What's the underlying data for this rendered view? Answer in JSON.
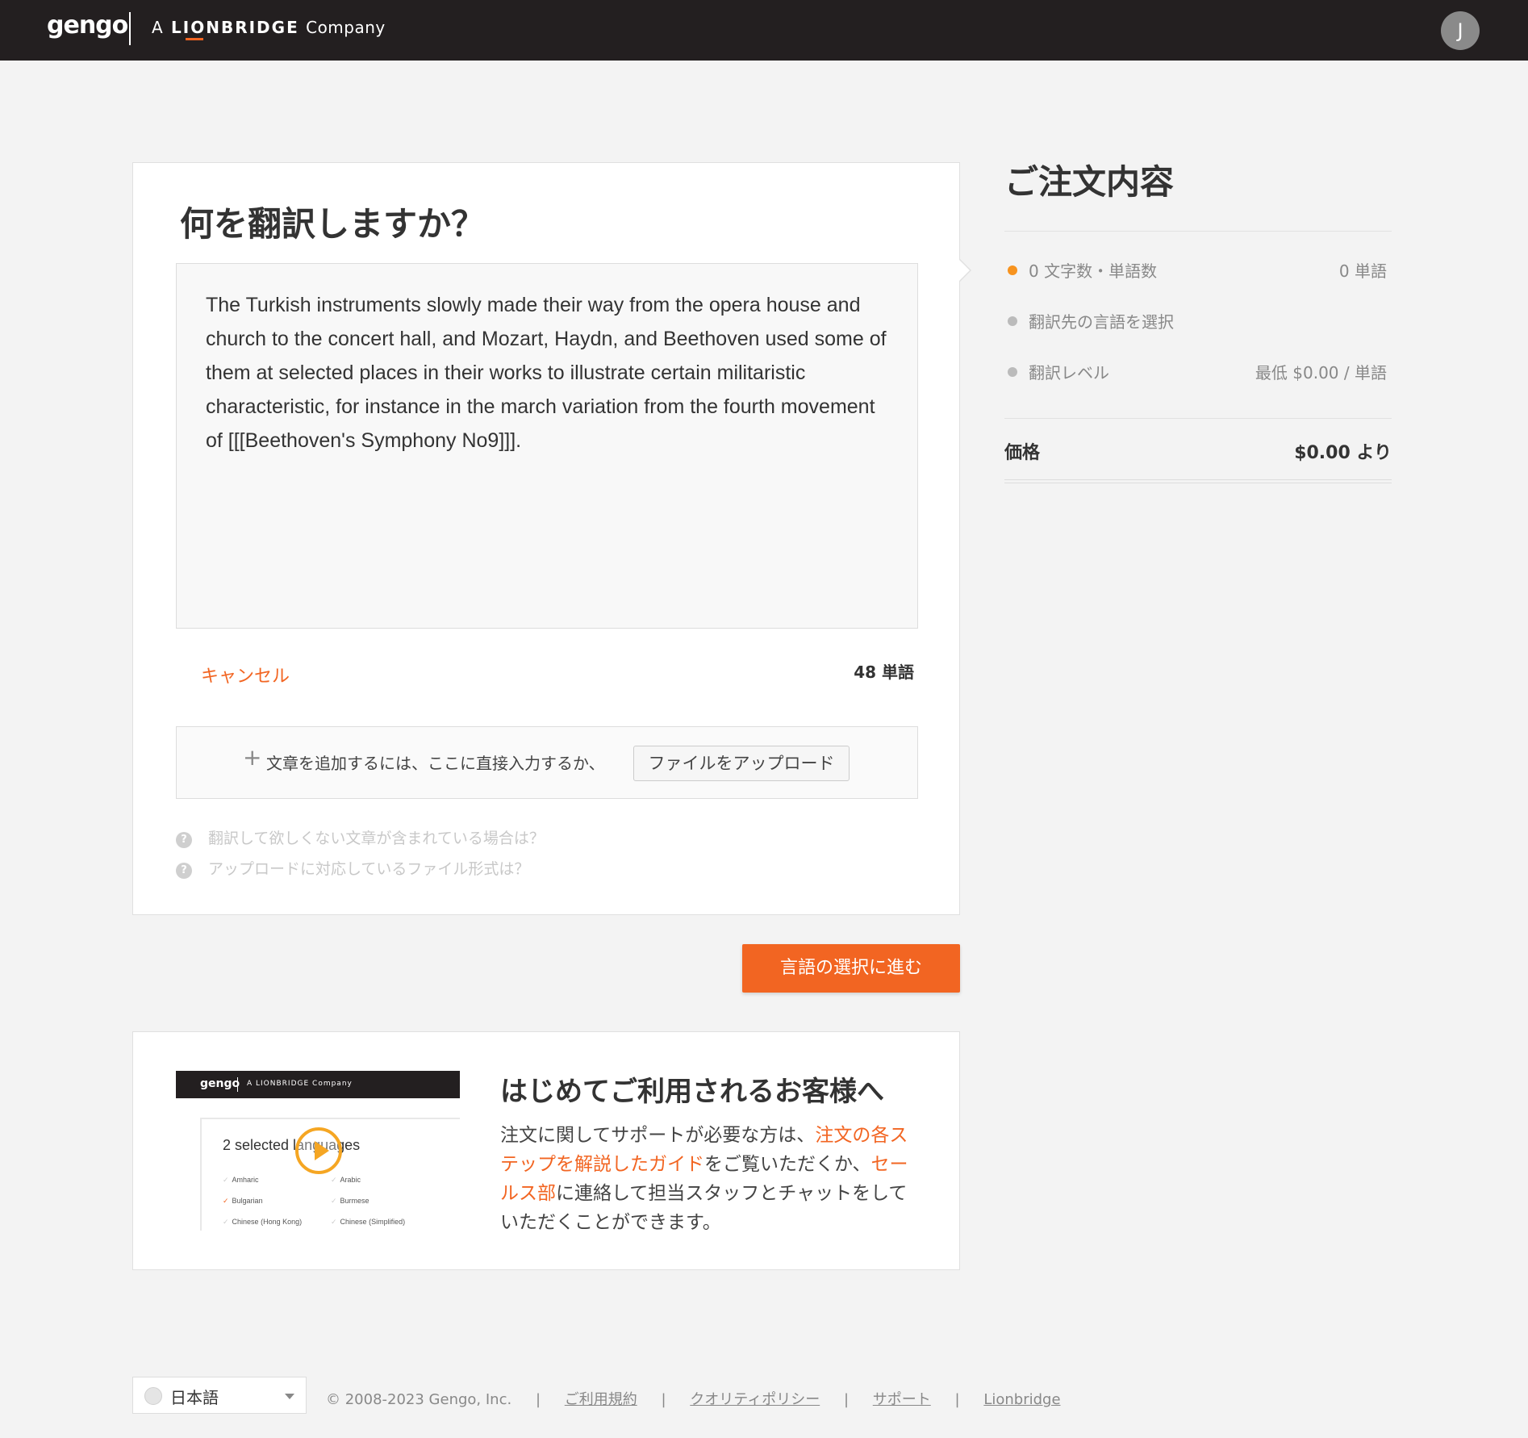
{
  "header": {
    "logo": "gengo",
    "company_prefix": "A",
    "company_name": "LIONBRIDGE",
    "company_suffix": "Company",
    "avatar_initial": "J"
  },
  "main": {
    "title": "何を翻訳しますか？",
    "text": "The Turkish instruments slowly made their way from the opera house and church to the concert hall, and Mozart, Haydn, and Beethoven used some of them at selected places in their works to illustrate certain militaristic characteristic, for instance in the march variation from the fourth movement of [[[Beethoven's Symphony No9]]].",
    "cancel_label": "キャンセル",
    "word_count": "48 単語",
    "upload_hint": "文章を追加するには、ここに直接入力するか、",
    "upload_button": "ファイルをアップロード",
    "faq": [
      "翻訳して欲しくない文章が含まれている場合は？",
      "アップロードに対応しているファイル形式は？"
    ]
  },
  "cta_label": "言語の選択に進む",
  "intro": {
    "title": "はじめてご利用されるお客様へ",
    "text_1": "注文に関してサポートが必要な方は、",
    "link_guide": "注文の各ステップを解説したガイド",
    "text_2": "をご覧いただくか、",
    "link_sales": "セールス部",
    "text_3": "に連絡して担当スタッフとチャットをしていただくことができます。",
    "video": {
      "logo": "gengo",
      "company": "A LIONBRIDGE Company",
      "heading": "2 selected languages",
      "languages": [
        "Amharic",
        "Arabic",
        "Bulgarian",
        "Burmese",
        "Chinese (Hong Kong)",
        "Chinese (Simplified)"
      ]
    }
  },
  "sidebar": {
    "title": "ご注文内容",
    "rows": [
      {
        "label": "0 文字数・単語数",
        "value": "0 単語"
      },
      {
        "label": "翻訳先の言語を選択",
        "value": ""
      },
      {
        "label": "翻訳レベル",
        "value": "最低 $0.00 / 単語"
      }
    ],
    "price_label": "価格",
    "price_value": "$0.00 より"
  },
  "footer": {
    "language": "日本語",
    "copyright": "© 2008-2023 Gengo, Inc.",
    "links": [
      "ご利用規約",
      "クオリティポリシー",
      "サポート",
      "Lionbridge"
    ]
  },
  "colors": {
    "accent": "#f26522",
    "header_bg": "#231f20",
    "active_dot": "#f7931e"
  }
}
